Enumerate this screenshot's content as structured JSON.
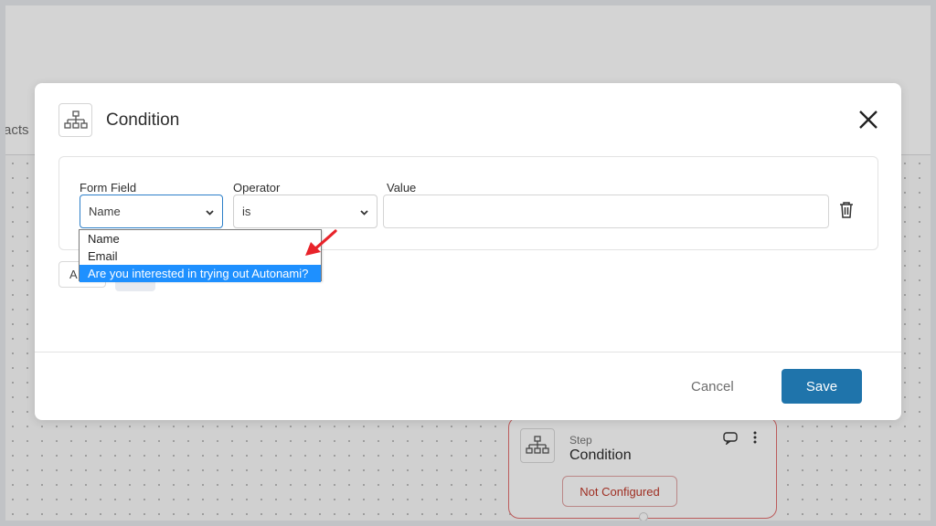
{
  "background": {
    "tab_text": "acts",
    "step_card": {
      "kicker": "Step",
      "title": "Condition",
      "status_badge": "Not Configured",
      "status_color": "#c0392b",
      "icon": "hierarchy-icon"
    }
  },
  "modal": {
    "title": "Condition",
    "icon": "hierarchy-icon",
    "rule": {
      "form_field": {
        "label": "Form Field",
        "selected": "Name"
      },
      "operator": {
        "label": "Operator",
        "selected": "is"
      },
      "value": {
        "label": "Value",
        "current": ""
      }
    },
    "add_button_partial": "A",
    "dropdown_options": [
      {
        "label": "Name",
        "highlighted": false
      },
      {
        "label": "Email",
        "highlighted": false
      },
      {
        "label": "Are you interested in trying out Autonami?",
        "highlighted": true
      }
    ],
    "cancel_label": "Cancel",
    "save_label": "Save",
    "accent_color": "#1f74ab"
  },
  "annotation": {
    "arrow_color": "#e8232a"
  }
}
